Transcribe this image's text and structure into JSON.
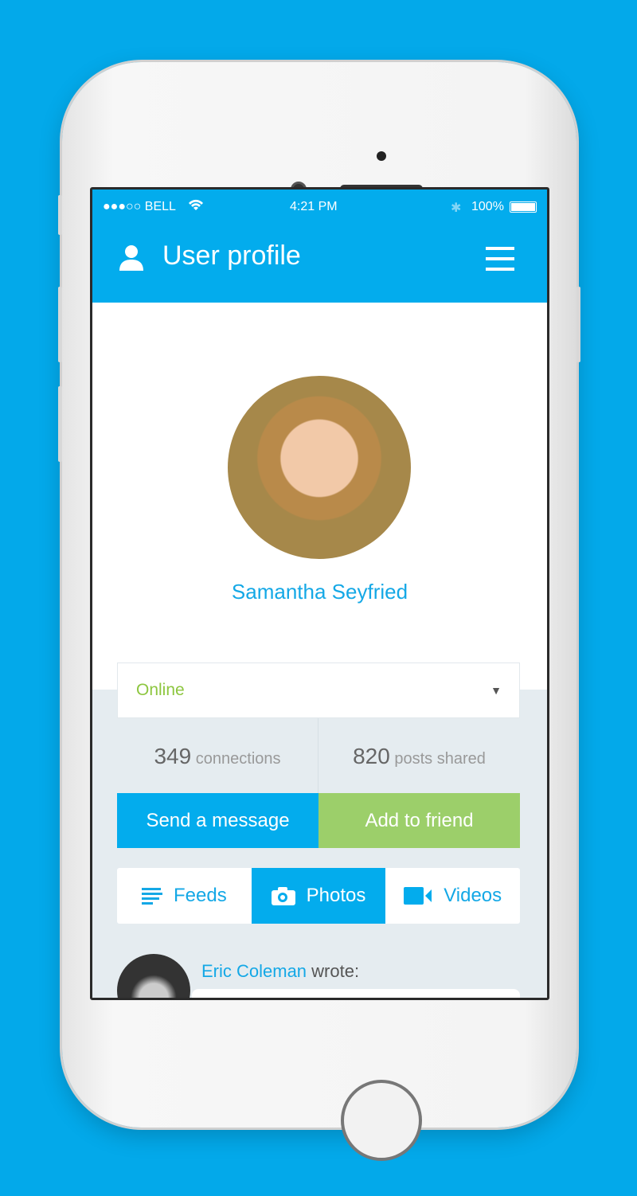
{
  "status_bar": {
    "carrier": "●●●○○ BELL",
    "time": "4:21 PM",
    "battery": "100%"
  },
  "header": {
    "title": "User profile"
  },
  "profile": {
    "name": "Samantha Seyfried",
    "status": "Online"
  },
  "stats": {
    "connections_count": "349",
    "connections_label": "connections",
    "posts_count": "820",
    "posts_label": "posts shared"
  },
  "actions": {
    "message": "Send a message",
    "friend": "Add to friend"
  },
  "tabs": [
    {
      "label": "Feeds",
      "active": false
    },
    {
      "label": "Photos",
      "active": true
    },
    {
      "label": "Videos",
      "active": false
    }
  ],
  "feed": {
    "author": "Eric Coleman",
    "action": "wrote:"
  },
  "colors": {
    "accent": "#03aced",
    "green": "#9ccf6a",
    "online": "#8dc63f",
    "background": "#e5ecf0"
  }
}
